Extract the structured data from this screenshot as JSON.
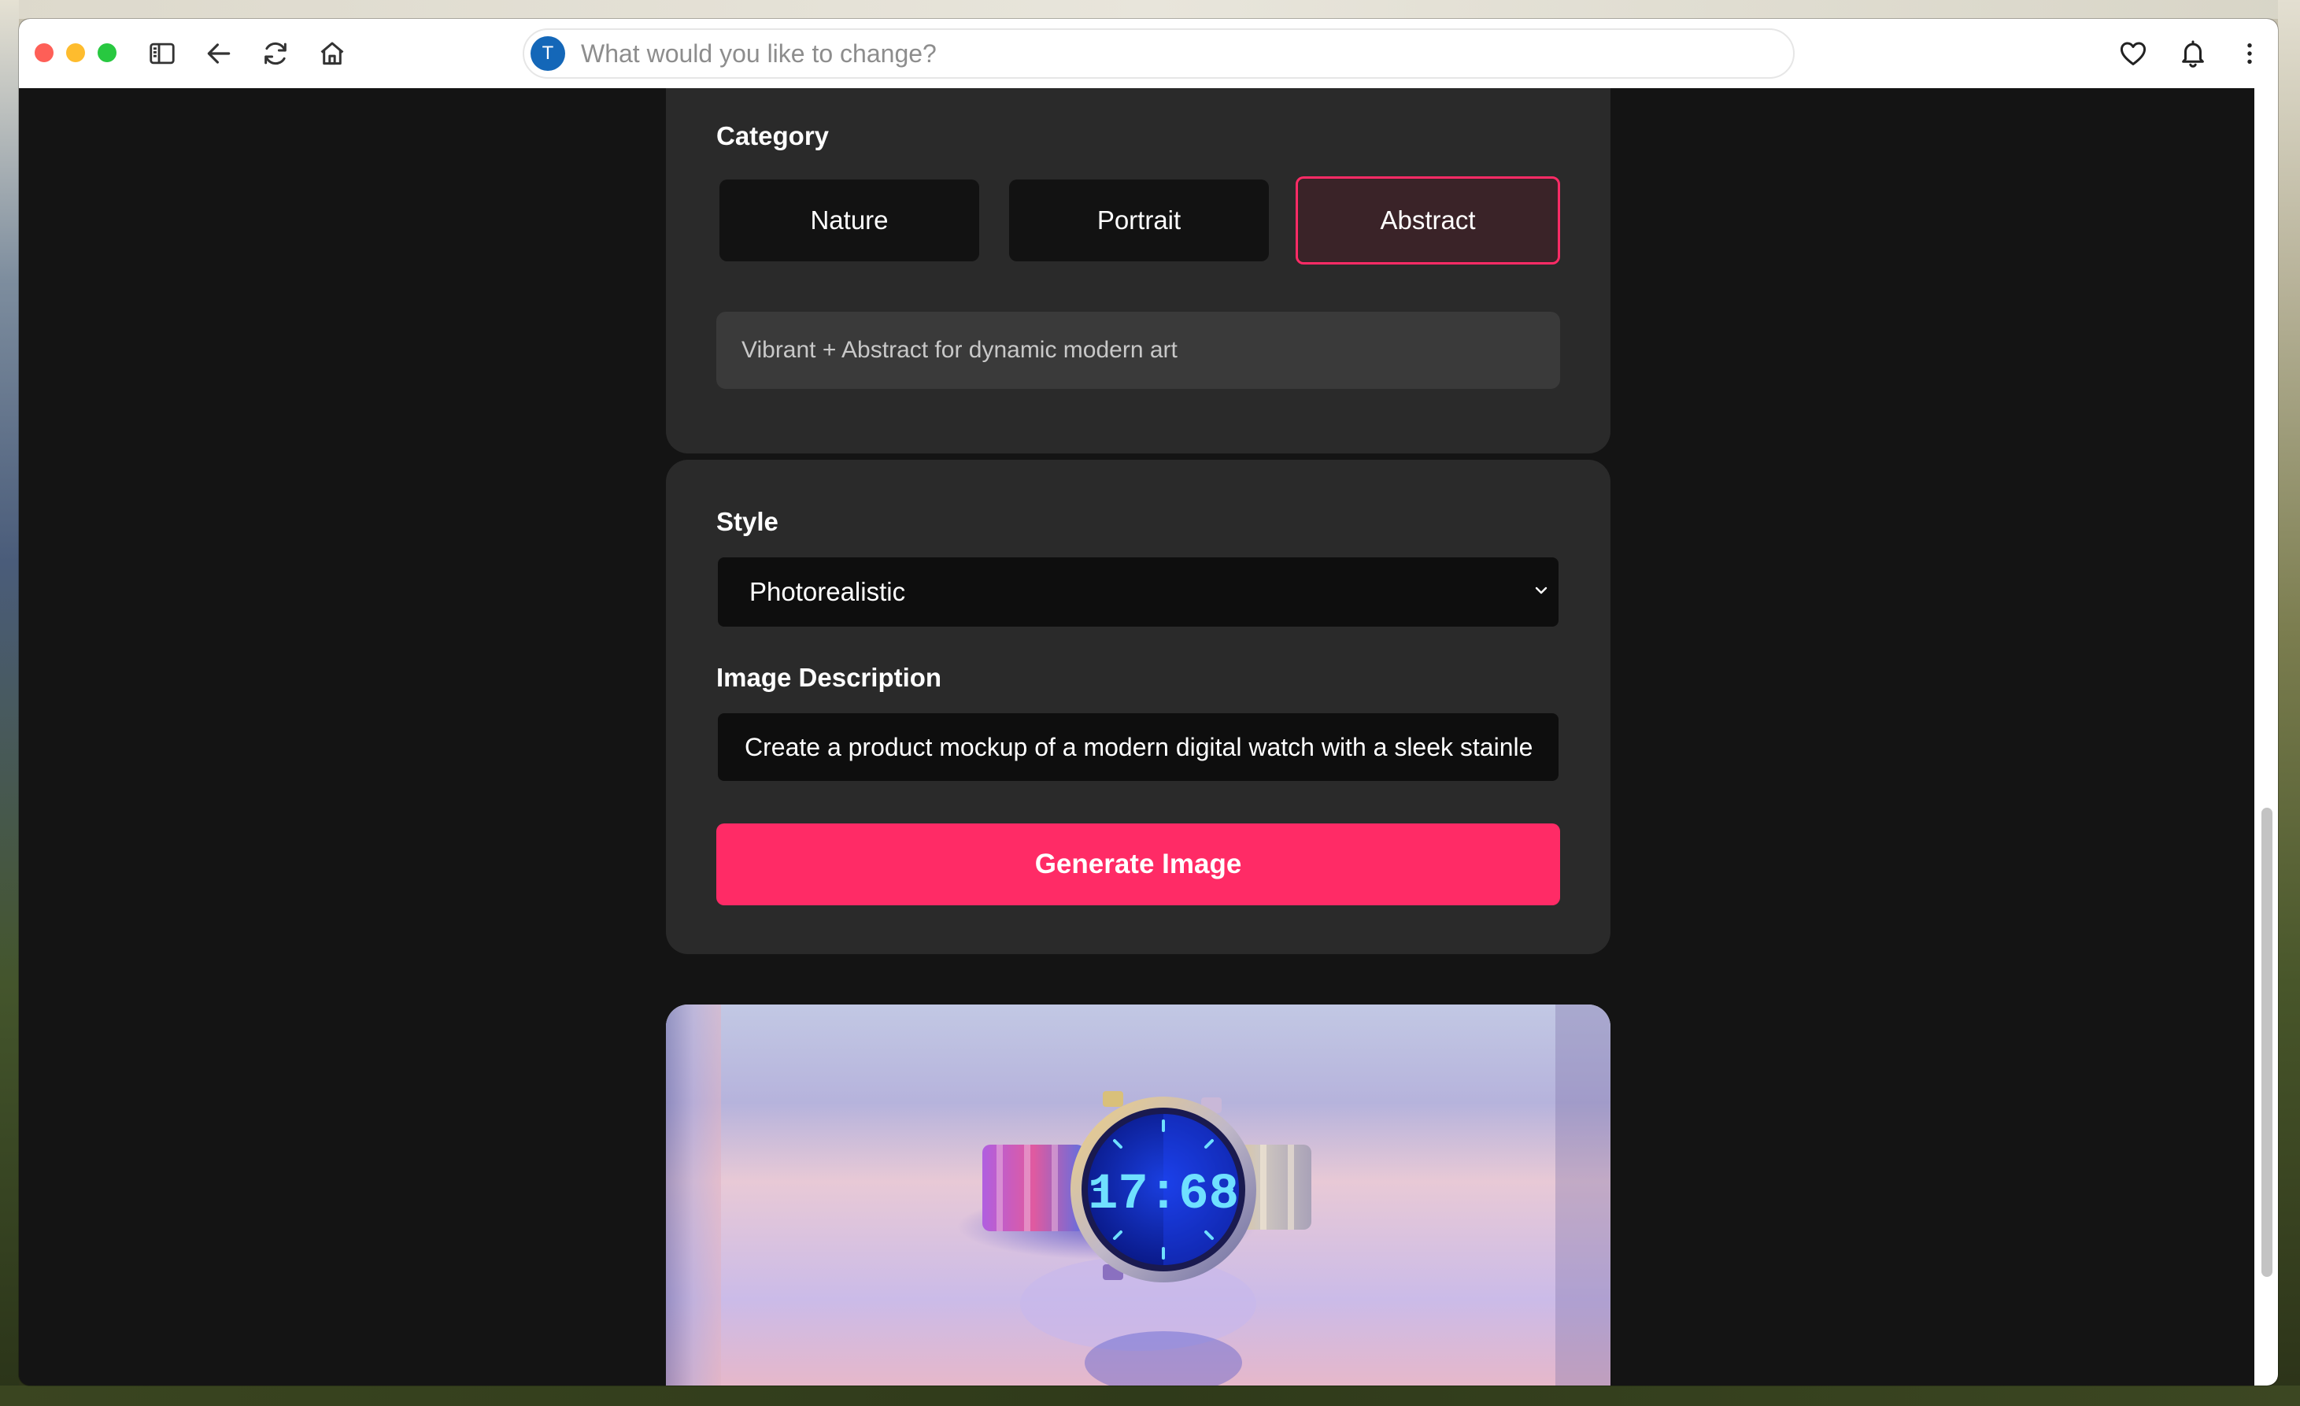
{
  "browser": {
    "address_bar": {
      "avatar_letter": "T",
      "placeholder": "What would you like to change?"
    },
    "icons": [
      "sidebar-icon",
      "back-arrow-icon",
      "reload-icon",
      "home-icon",
      "heart-icon",
      "bell-icon",
      "more-vertical-icon"
    ]
  },
  "category_panel": {
    "label": "Category",
    "options": [
      "Nature",
      "Portrait",
      "Abstract"
    ],
    "selected": "Abstract",
    "hint": "Vibrant + Abstract for dynamic modern art"
  },
  "form_panel": {
    "style_label": "Style",
    "style_value": "Photorealistic",
    "description_label": "Image Description",
    "description_value": "Create a product mockup of a modern digital watch with a sleek stainle",
    "generate_label": "Generate Image"
  },
  "result": {
    "image_subject": "digital watch product photo",
    "watch_display": "17:68"
  },
  "colors": {
    "accent": "#ff2b66",
    "panel": "#2a2a2a",
    "page_bg": "#141414",
    "selected_bg": "#3a2328",
    "avatar": "#1467b8"
  }
}
